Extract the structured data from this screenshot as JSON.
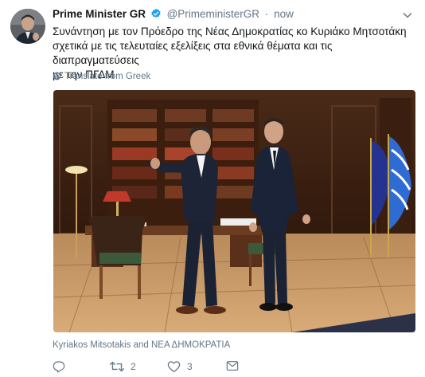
{
  "tweet": {
    "display_name": "Prime Minister GR",
    "handle": "@PrimeministerGR",
    "separator": "·",
    "time": "now",
    "text": "Συνάντηση με τον Πρόεδρο της Νέας Δημοκρατίας κο Κυριάκο Μητσοτάκη\nσχετικά με τις τελευταίες εξελίξεις στα εθνικά θέματα και τις διαπραγματεύσεις\nμε την ΠΓΔΜ",
    "translate_label": "Translate from Greek",
    "media_caption": "Kyriakos Mitsotakis and ΝΕΑ ΔΗΜΟΚΡΑΤΙΑ"
  },
  "actions": {
    "replies": "",
    "retweets": "2",
    "likes": "3"
  },
  "colors": {
    "accent": "#1da1f2",
    "secondary_text": "#657786"
  },
  "icons": [
    "avatar",
    "verified-icon",
    "chevron-down-icon",
    "globe-icon",
    "reply-icon",
    "retweet-icon",
    "like-icon",
    "message-icon"
  ]
}
